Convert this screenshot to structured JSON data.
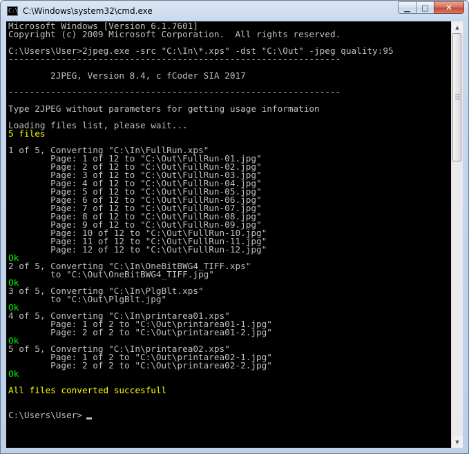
{
  "window": {
    "title": "C:\\Windows\\system32\\cmd.exe",
    "icon": "cmd-icon",
    "icon_glyph": "C:\\",
    "buttons": {
      "minimize": "minimize-icon",
      "maximize": "maximize-icon",
      "close": "close-icon"
    },
    "button_glyphs": {
      "minimize": "▁",
      "maximize": "□",
      "close": "✕"
    }
  },
  "colors": {
    "console_background": "#000000",
    "console_text": "#c0c0c0",
    "ok_text": "#00ff00",
    "highlight_text": "#ffff00"
  },
  "console": {
    "lines": [
      {
        "text": "Microsoft Windows [Version 6.1.7601]",
        "color": "gray"
      },
      {
        "text": "Copyright (c) 2009 Microsoft Corporation.  All rights reserved.",
        "color": "gray"
      },
      {
        "text": "",
        "color": "gray"
      },
      {
        "text": "C:\\Users\\User>2jpeg.exe -src \"C:\\In\\*.xps\" -dst \"C:\\Out\" -jpeg quality:95",
        "color": "gray"
      },
      {
        "text": "---------------------------------------------------------------",
        "color": "gray"
      },
      {
        "text": "",
        "color": "gray"
      },
      {
        "text": "        2JPEG, Version 8.4, c fCoder SIA 2017",
        "color": "gray"
      },
      {
        "text": "",
        "color": "gray"
      },
      {
        "text": "---------------------------------------------------------------",
        "color": "gray"
      },
      {
        "text": "",
        "color": "gray"
      },
      {
        "text": "Type 2JPEG without parameters for getting usage information",
        "color": "gray"
      },
      {
        "text": "",
        "color": "gray"
      },
      {
        "text": "Loading files list, please wait...",
        "color": "gray"
      },
      {
        "text": "5 files",
        "color": "yellow"
      },
      {
        "text": "",
        "color": "gray"
      },
      {
        "text": "1 of 5, Converting \"C:\\In\\FullRun.xps\"",
        "color": "gray"
      },
      {
        "text": "        Page: 1 of 12 to \"C:\\Out\\FullRun-01.jpg\"",
        "color": "gray"
      },
      {
        "text": "        Page: 2 of 12 to \"C:\\Out\\FullRun-02.jpg\"",
        "color": "gray"
      },
      {
        "text": "        Page: 3 of 12 to \"C:\\Out\\FullRun-03.jpg\"",
        "color": "gray"
      },
      {
        "text": "        Page: 4 of 12 to \"C:\\Out\\FullRun-04.jpg\"",
        "color": "gray"
      },
      {
        "text": "        Page: 5 of 12 to \"C:\\Out\\FullRun-05.jpg\"",
        "color": "gray"
      },
      {
        "text": "        Page: 6 of 12 to \"C:\\Out\\FullRun-06.jpg\"",
        "color": "gray"
      },
      {
        "text": "        Page: 7 of 12 to \"C:\\Out\\FullRun-07.jpg\"",
        "color": "gray"
      },
      {
        "text": "        Page: 8 of 12 to \"C:\\Out\\FullRun-08.jpg\"",
        "color": "gray"
      },
      {
        "text": "        Page: 9 of 12 to \"C:\\Out\\FullRun-09.jpg\"",
        "color": "gray"
      },
      {
        "text": "        Page: 10 of 12 to \"C:\\Out\\FullRun-10.jpg\"",
        "color": "gray"
      },
      {
        "text": "        Page: 11 of 12 to \"C:\\Out\\FullRun-11.jpg\"",
        "color": "gray"
      },
      {
        "text": "        Page: 12 of 12 to \"C:\\Out\\FullRun-12.jpg\"",
        "color": "gray"
      },
      {
        "text": "Ok",
        "color": "green"
      },
      {
        "text": "2 of 5, Converting \"C:\\In\\OneBitBWG4_TIFF.xps\"",
        "color": "gray"
      },
      {
        "text": "        to \"C:\\Out\\OneBitBWG4_TIFF.jpg\"",
        "color": "gray"
      },
      {
        "text": "Ok",
        "color": "green"
      },
      {
        "text": "3 of 5, Converting \"C:\\In\\PlgBlt.xps\"",
        "color": "gray"
      },
      {
        "text": "        to \"C:\\Out\\PlgBlt.jpg\"",
        "color": "gray"
      },
      {
        "text": "Ok",
        "color": "green"
      },
      {
        "text": "4 of 5, Converting \"C:\\In\\printarea01.xps\"",
        "color": "gray"
      },
      {
        "text": "        Page: 1 of 2 to \"C:\\Out\\printarea01-1.jpg\"",
        "color": "gray"
      },
      {
        "text": "        Page: 2 of 2 to \"C:\\Out\\printarea01-2.jpg\"",
        "color": "gray"
      },
      {
        "text": "Ok",
        "color": "green"
      },
      {
        "text": "5 of 5, Converting \"C:\\In\\printarea02.xps\"",
        "color": "gray"
      },
      {
        "text": "        Page: 1 of 2 to \"C:\\Out\\printarea02-1.jpg\"",
        "color": "gray"
      },
      {
        "text": "        Page: 2 of 2 to \"C:\\Out\\printarea02-2.jpg\"",
        "color": "gray"
      },
      {
        "text": "Ok",
        "color": "green"
      },
      {
        "text": "",
        "color": "gray"
      },
      {
        "text": "All files converted succesfull",
        "color": "yellow"
      },
      {
        "text": "",
        "color": "gray"
      },
      {
        "text": "",
        "color": "gray"
      },
      {
        "text": "C:\\Users\\User>",
        "color": "gray"
      }
    ]
  },
  "scrollbar": {
    "position_fraction": 0.0,
    "up_icon": "scroll-up-arrow-icon",
    "down_icon": "scroll-down-arrow-icon",
    "up_glyph": "▲",
    "down_glyph": "▼"
  }
}
